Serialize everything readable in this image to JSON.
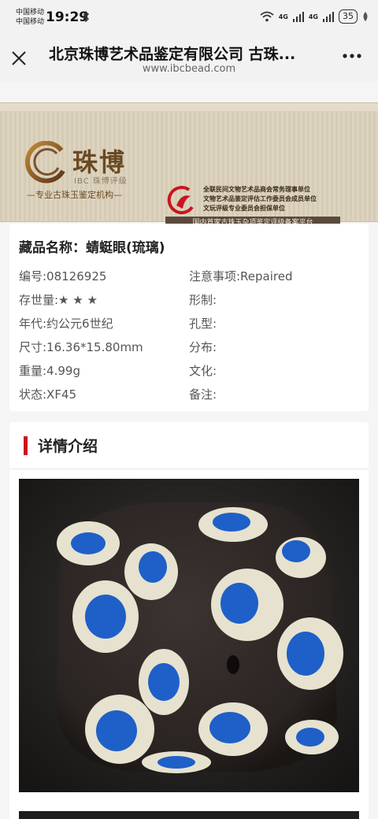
{
  "status_bar": {
    "carrier_1": "中国移动",
    "carrier_2": "中国移动",
    "time": "19:29",
    "net_1": "4G",
    "net_2": "4G",
    "battery": "35"
  },
  "title_bar": {
    "title": "北京珠博艺术品鉴定有限公司 古珠...",
    "url": "www.ibcbead.com"
  },
  "banner": {
    "logo_cn": "珠博",
    "logo_en": "IBC 珠博评级",
    "slogan": "—专业古珠玉鉴定机构—",
    "assoc_1": "全联民间文物艺术品商会常务理事单位",
    "assoc_2": "文物艺术品鉴定评估工作委员会成员单位",
    "assoc_3": "文玩评级专业委员会担保单位",
    "bar_text": "国内首家古珠玉杂项鉴定评级备案平台"
  },
  "item": {
    "name": "藏品名称：蜻蜓眼(琉璃)",
    "serial": "编号:08126925",
    "notice": "注意事项:Repaired",
    "rarity": "存世量:★ ★ ★",
    "shape": "形制:",
    "era": "年代:约公元6世纪",
    "hole": "孔型:",
    "size": "尺寸:16.36*15.80mm",
    "distribution": "分布:",
    "weight": "重量:4.99g",
    "culture": "文化:",
    "condition": "状态:XF45",
    "remark": "备注:"
  },
  "detail": {
    "title": "详情介绍"
  },
  "colors": {
    "accent_red": "#c8161d",
    "bead_blue": "#1f5fc8",
    "eye_white": "#e6e2cf"
  }
}
